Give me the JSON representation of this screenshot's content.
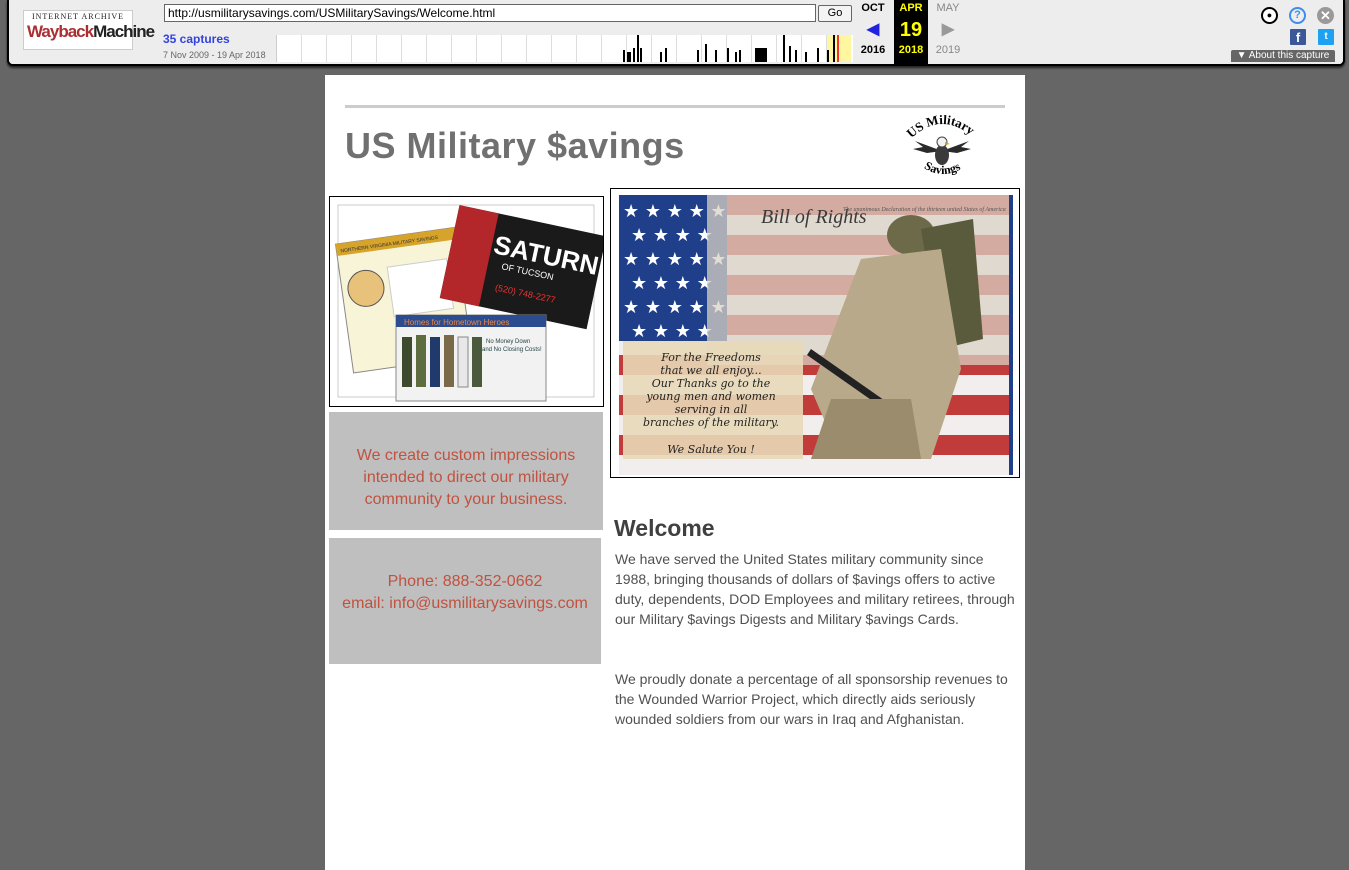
{
  "toolbar": {
    "logo_top": "INTERNET ARCHIVE",
    "logo_wayback": "Wayback",
    "logo_machine": "Machine",
    "url": "http://usmilitarysavings.com/USMilitarySavings/Welcome.html",
    "go_label": "Go",
    "captures": "35 captures",
    "date_range": "7 Nov 2009 - 19 Apr 2018",
    "prev": {
      "month": "OCT",
      "year": "2016"
    },
    "current": {
      "month": "APR",
      "day": "19",
      "year": "2018"
    },
    "next": {
      "month": "MAY",
      "year": "2019"
    },
    "about_label": "▼ About this capture",
    "colors": {
      "accent": "#3344dd",
      "highlight": "#ffff00",
      "capture_bar": "#000000"
    }
  },
  "site": {
    "title": "US Military $avings",
    "logo_text_top": "US Military",
    "logo_text_bottom": "Savings",
    "promo_image": {
      "card1_header": "NORTHERN VIRGINIA MILITARY SAVINGS",
      "card2_brand": "SATURN",
      "card2_sub": "OF TUCSON",
      "card2_phone": "(520) 748-2277",
      "card3_header": "Homes for Hometown Heroes",
      "card3_line1": "No Money Down",
      "card3_line2": "and No Closing Costs!"
    },
    "flag_image": {
      "doc_title": "Bill of Rights",
      "doc_header": "The unanimous Declaration of the thirteen united States of America",
      "caption_lines": [
        "For the Freedoms",
        "that we all enjoy...",
        "Our Thanks go to the",
        "young men and women",
        "serving in all",
        "branches of the military."
      ],
      "salute": "We Salute You !"
    },
    "impressions_text": "We create custom impressions intended to direct our military community to your business.",
    "phone_text": "Phone: 888-352-0662",
    "email_text": "email: info@usmilitarysavings.com",
    "welcome_heading": "Welcome",
    "paragraph1": "We have served the United States military community since 1988, bringing thousands of dollars of $avings offers to active duty, dependents, DOD Employees and military retirees, through our Military $avings Digests and Military $avings Cards.",
    "paragraph2": "We proudly donate a percentage of all sponsorship revenues to the Wounded Warrior Project, which directly aids seriously wounded soldiers from our wars in Iraq and Afghanistan.",
    "colors": {
      "title": "#707070",
      "contact_text": "#c0523f",
      "box_bg": "#bfbfbf"
    }
  }
}
